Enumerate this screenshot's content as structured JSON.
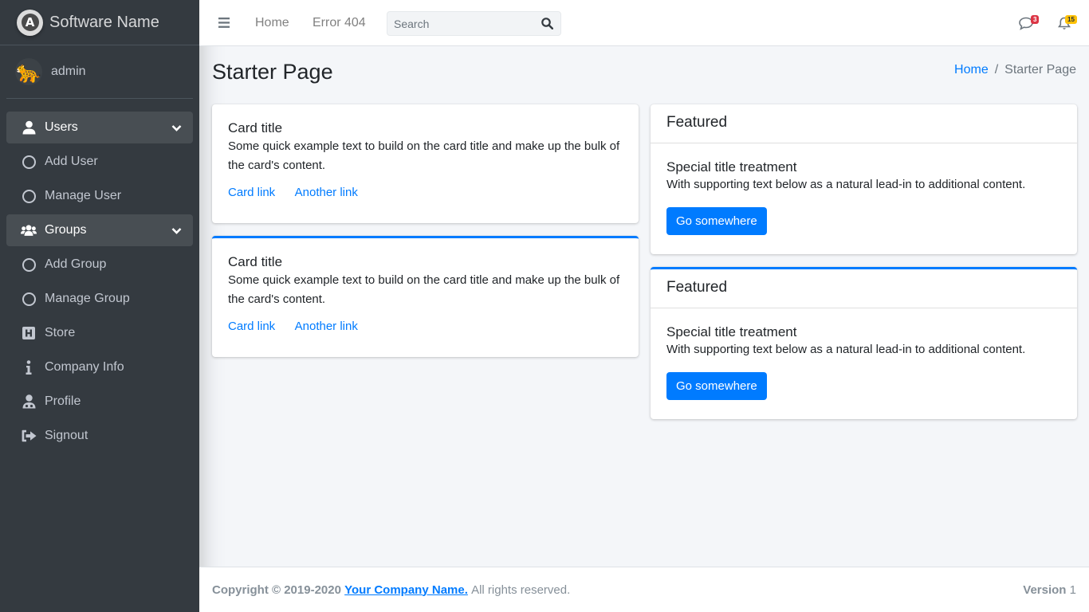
{
  "brand": {
    "name": "Software Name"
  },
  "user": {
    "name": "admin"
  },
  "sidebar": {
    "items": [
      {
        "label": "Users",
        "icon": "user-icon",
        "open": true
      },
      {
        "label": "Add User",
        "icon": "circle-icon"
      },
      {
        "label": "Manage User",
        "icon": "circle-icon"
      },
      {
        "label": "Groups",
        "icon": "users-icon",
        "open": true
      },
      {
        "label": "Add Group",
        "icon": "circle-icon"
      },
      {
        "label": "Manage Group",
        "icon": "circle-icon"
      },
      {
        "label": "Store",
        "icon": "hospital-icon"
      },
      {
        "label": "Company Info",
        "icon": "info-icon"
      },
      {
        "label": "Profile",
        "icon": "user-doctor-icon"
      },
      {
        "label": "Signout",
        "icon": "sign-out-icon"
      }
    ]
  },
  "topbar": {
    "links": [
      "Home",
      "Error 404"
    ],
    "search_placeholder": "Search",
    "messages_count": "3",
    "notifications_count": "15"
  },
  "page": {
    "title": "Starter Page",
    "breadcrumb": [
      "Home",
      "Starter Page"
    ]
  },
  "cards": [
    {
      "title": "Card title",
      "text": "Some quick example text to build on the card title and make up the bulk of the card's content.",
      "link1": "Card link",
      "link2": "Another link"
    },
    {
      "title": "Card title",
      "text": "Some quick example text to build on the card title and make up the bulk of the card's content.",
      "link1": "Card link",
      "link2": "Another link"
    }
  ],
  "featured": [
    {
      "header": "Featured",
      "title": "Special title treatment",
      "text": "With supporting text below as a natural lead-in to additional content.",
      "button": "Go somewhere"
    },
    {
      "header": "Featured",
      "title": "Special title treatment",
      "text": "With supporting text below as a natural lead-in to additional content.",
      "button": "Go somewhere"
    }
  ],
  "footer": {
    "copyright": "Copyright © 2019-2020",
    "company": "Your Company Name.",
    "rights": "All rights reserved.",
    "version_label": "Version",
    "version": "1"
  },
  "colors": {
    "primary": "#007bff",
    "sidebar": "#343a40",
    "danger": "#dc3545",
    "warning": "#ffc107"
  }
}
